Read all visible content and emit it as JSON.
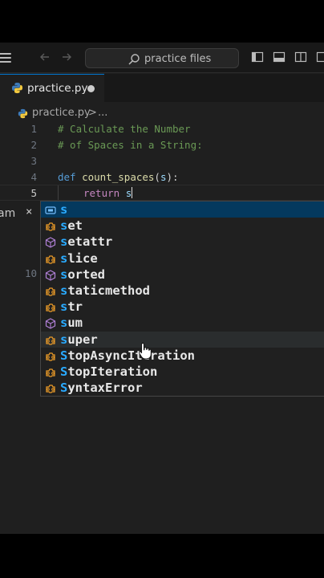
{
  "titlebar": {
    "search_placeholder": "practice files",
    "icons": [
      "hamburger-menu-icon",
      "back-arrow-icon",
      "forward-arrow-icon",
      "search-icon",
      "toggle-sidebar-icon",
      "toggle-panel-icon",
      "toggle-secondary-sidebar-icon",
      "customize-layout-icon"
    ]
  },
  "tabs": [
    {
      "label": "practice.py",
      "modified": true
    }
  ],
  "breadcrumb": {
    "file": "practice.py",
    "separator": ">",
    "more": "..."
  },
  "editor": {
    "lines": [
      {
        "number": "1",
        "text": "# Calculate the Number"
      },
      {
        "number": "2",
        "text": "# of Spaces in a String:"
      },
      {
        "number": "3",
        "text": ""
      },
      {
        "number": "4",
        "def": "def",
        "name": "count_spaces",
        "open": "(",
        "param": "s",
        "close": "):"
      },
      {
        "number": "5",
        "kw": "return",
        "typed": "s"
      }
    ],
    "hidden_line_number": "10",
    "side_fragment": "am",
    "side_close": "×"
  },
  "suggestions": [
    {
      "label": "s",
      "kind": "variable",
      "match": "s",
      "rest": ""
    },
    {
      "label": "set",
      "kind": "class",
      "match": "s",
      "rest": "et"
    },
    {
      "label": "setattr",
      "kind": "method",
      "match": "s",
      "rest": "etattr"
    },
    {
      "label": "slice",
      "kind": "class",
      "match": "s",
      "rest": "lice"
    },
    {
      "label": "sorted",
      "kind": "method",
      "match": "s",
      "rest": "orted"
    },
    {
      "label": "staticmethod",
      "kind": "class",
      "match": "s",
      "rest": "taticmethod"
    },
    {
      "label": "str",
      "kind": "class",
      "match": "s",
      "rest": "tr"
    },
    {
      "label": "sum",
      "kind": "method",
      "match": "s",
      "rest": "um"
    },
    {
      "label": "super",
      "kind": "class",
      "match": "s",
      "rest": "uper"
    },
    {
      "label": "StopAsyncIteration",
      "kind": "class",
      "match": "S",
      "rest": "topAsyncIteration"
    },
    {
      "label": "StopIteration",
      "kind": "class",
      "match": "S",
      "rest": "topIteration"
    },
    {
      "label": "SyntaxError",
      "kind": "class",
      "match": "S",
      "rest": "yntaxError"
    }
  ],
  "colors": {
    "accent": "#0078d4",
    "selection": "#04395e",
    "match": "#2aaaff",
    "class_icon": "#ee9d28",
    "method_icon": "#b180d7"
  }
}
